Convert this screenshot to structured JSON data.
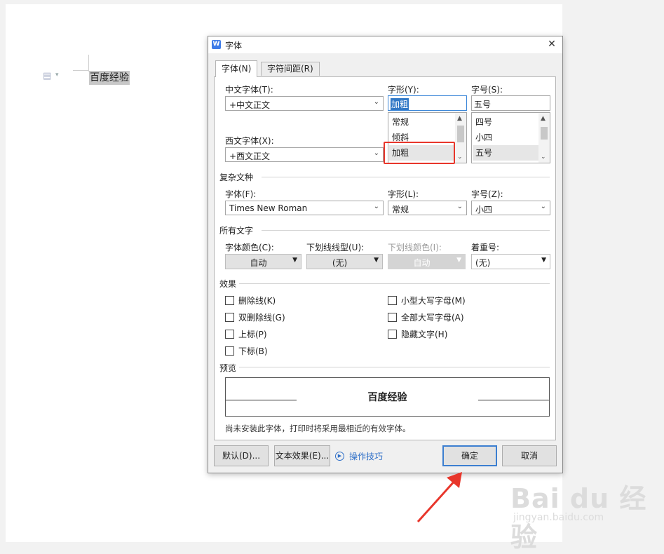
{
  "document": {
    "text": "百度经验"
  },
  "dialog": {
    "title": "字体",
    "app_icon": "W",
    "close": "✕",
    "tabs": [
      "字体(N)",
      "字符间距(R)"
    ],
    "chinese_font": {
      "label": "中文字体(T):",
      "value": "+中文正文"
    },
    "western_font": {
      "label": "西文字体(X):",
      "value": "+西文正文"
    },
    "style": {
      "label": "字形(Y):",
      "value": "加粗",
      "options": [
        "常规",
        "倾斜",
        "加粗"
      ],
      "selected": "加粗"
    },
    "size": {
      "label": "字号(S):",
      "value": "五号",
      "options": [
        "四号",
        "小四",
        "五号"
      ],
      "selected": "五号"
    },
    "complex": {
      "section": "复杂文种",
      "font_label": "字体(F):",
      "font_value": "Times New Roman",
      "style_label": "字形(L):",
      "style_value": "常规",
      "size_label": "字号(Z):",
      "size_value": "小四"
    },
    "all_text": {
      "section": "所有文字",
      "color_label": "字体颜色(C):",
      "color_value": "自动",
      "underline_label": "下划线线型(U):",
      "underline_value": "(无)",
      "underline_color_label": "下划线颜色(I):",
      "underline_color_value": "自动",
      "emphasis_label": "着重号:",
      "emphasis_value": "(无)"
    },
    "effects": {
      "section": "效果",
      "left": [
        "删除线(K)",
        "双删除线(G)",
        "上标(P)",
        "下标(B)"
      ],
      "right": [
        "小型大写字母(M)",
        "全部大写字母(A)",
        "隐藏文字(H)"
      ]
    },
    "preview": {
      "section": "预览",
      "sample": "百度经验",
      "note": "尚未安装此字体，打印时将采用最相近的有效字体。"
    },
    "buttons": {
      "default": "默认(D)...",
      "text_effects": "文本效果(E)...",
      "tips": "操作技巧",
      "ok": "确定",
      "cancel": "取消"
    }
  },
  "watermark": {
    "logo": "Bai du 经验",
    "url": "jingyan.baidu.com"
  },
  "colors": {
    "highlight_box": "#e8362b",
    "arrow": "#e8362b",
    "accent": "#3c7fd0"
  }
}
